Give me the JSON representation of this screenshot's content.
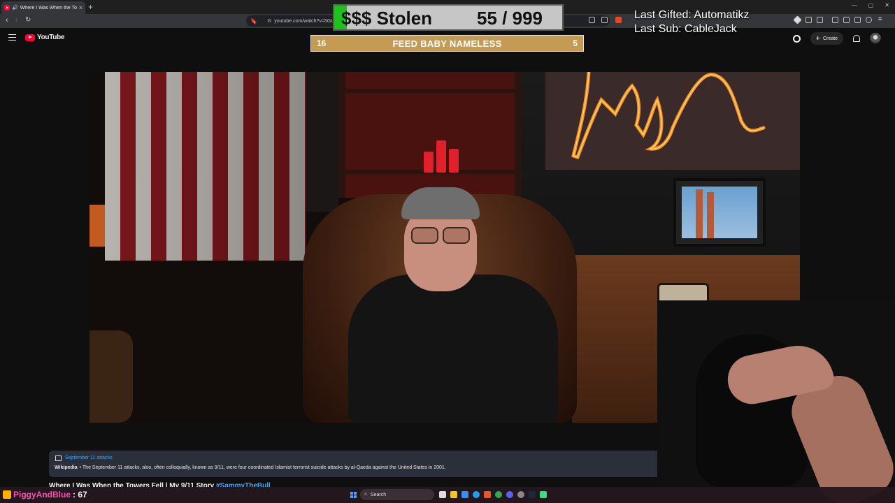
{
  "browser": {
    "tab_title": "Where I Was When the Towers",
    "tab_close": "×",
    "new_tab": "+",
    "url": "youtube.com/watch?v=5GU",
    "win_controls": [
      "—",
      "▢",
      "✕"
    ]
  },
  "youtube": {
    "logo_text": "YouTube",
    "create_label": "Create"
  },
  "overlay": {
    "stolen_label": "$$$ Stolen",
    "stolen_count": "55 / 999",
    "stolen_progress": 0.055,
    "feed_left": "16",
    "feed_title": "FEED BABY NAMELESS",
    "feed_right": "5",
    "last_gifted": "Last Gifted: Automatikz",
    "last_sub": "Last Sub: CableJack"
  },
  "info_panel": {
    "title": "September 11 attacks",
    "source": "Wikipedia",
    "text": "• The September 11 attacks, also, often colloquially, known as 9/11, were four coordinated Islamist terrorist suicide attacks by al-Qaeda against the United States in 2001."
  },
  "video": {
    "title": "Where I Was When the Towers Fell | My 9/11 Story",
    "hashtag": "#SammyTheBull"
  },
  "chat": {
    "username": "PiggyAndBlue",
    "value": ": 67"
  },
  "taskbar": {
    "search_label": "Search"
  },
  "colors": {
    "stolen_fill": "#1fc11f",
    "feed_bg": "#c59a52",
    "youtube_red": "#ff0033",
    "link_blue": "#3ea6ff",
    "chat_user": "#ff4fb0"
  }
}
